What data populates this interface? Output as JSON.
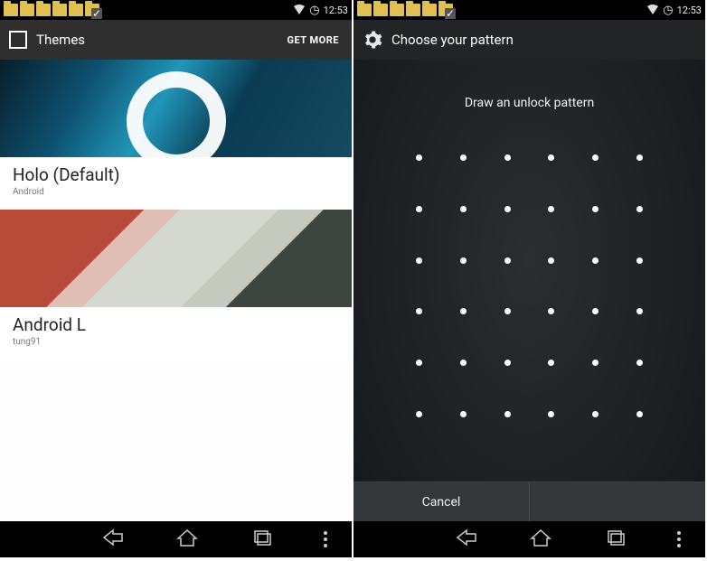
{
  "left": {
    "statusbar": {
      "time": "12:53"
    },
    "appbar": {
      "title": "Themes",
      "action": "GET MORE"
    },
    "themes": [
      {
        "name": "Holo (Default)",
        "author": "Android"
      },
      {
        "name": "Android L",
        "author": "tung91"
      }
    ]
  },
  "right": {
    "statusbar": {
      "time": "12:53"
    },
    "appbar": {
      "title": "Choose your pattern"
    },
    "prompt": "Draw an unlock pattern",
    "pattern_grid_size": 6,
    "buttons": {
      "cancel": "Cancel",
      "confirm": ""
    }
  }
}
